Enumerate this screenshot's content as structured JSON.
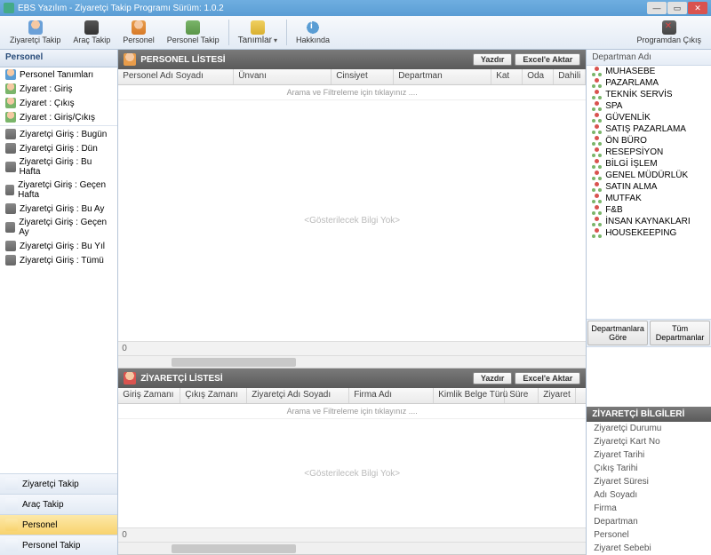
{
  "title": "EBS Yazılım  - Ziyaretçi Takip Programı Sürüm: 1.0.2",
  "toolbar": {
    "ziyaretci": "Ziyaretçi Takip",
    "arac": "Araç Takip",
    "personel": "Personel",
    "ptakip": "Personel Takip",
    "tanimlar": "Tanımlar",
    "hakkinda": "Hakkında",
    "cikis": "Programdan Çıkış"
  },
  "sidebar": {
    "header": "Personel",
    "items": [
      "Personel Tanımları",
      "Ziyaret : Giriş",
      "Ziyaret : Çıkış",
      "Ziyaret : Giriş/Çıkış",
      "Ziyaretçi Giriş : Bugün",
      "Ziyaretçi Giriş : Dün",
      "Ziyaretçi Giriş : Bu Hafta",
      "Ziyaretçi Giriş : Geçen Hafta",
      "Ziyaretçi Giriş : Bu Ay",
      "Ziyaretçi Giriş : Geçen Ay",
      "Ziyaretçi Giriş : Bu Yıl",
      "Ziyaretçi Giriş : Tümü"
    ],
    "nav": [
      "Ziyaretçi Takip",
      "Araç Takip",
      "Personel",
      "Personel Takip"
    ],
    "active": 2
  },
  "personel_panel": {
    "title": "PERSONEL LİSTESİ",
    "yazdir": "Yazdır",
    "excel": "Excel'e Aktar",
    "cols": [
      "Personel Adı Soyadı",
      "Ünvanı",
      "Cinsiyet",
      "Departman",
      "Kat",
      "Oda",
      "Dahili"
    ],
    "filter_hint": "Arama ve Filtreleme için tıklayınız ....",
    "empty": "<Gösterilecek Bilgi Yok>",
    "count": "0"
  },
  "ziyaretci_panel": {
    "title": "ZİYARETÇİ LİSTESİ",
    "yazdir": "Yazdır",
    "excel": "Excel'e Aktar",
    "cols": [
      "Giriş Zamanı",
      "Çıkış Zamanı",
      "Ziyaretçi Adı Soyadı",
      "Firma Adı",
      "Kimlik Belge Türü",
      "Süre",
      "Ziyaret"
    ],
    "filter_hint": "Arama ve Filtreleme için tıklayınız ....",
    "empty": "<Gösterilecek Bilgi Yok>",
    "count": "0"
  },
  "right": {
    "dept_header": "Departman Adı",
    "depts": [
      "MUHASEBE",
      "PAZARLAMA",
      "TEKNİK SERVİS",
      "SPA",
      "GÜVENLİK",
      "SATIŞ PAZARLAMA",
      "ÖN BÜRO",
      "RESEPSİYON",
      "BİLGİ İŞLEM",
      "GENEL MÜDÜRLÜK",
      "SATIN ALMA",
      "MUTFAK",
      "F&B",
      "İNSAN KAYNAKLARI",
      "HOUSEKEEPING"
    ],
    "btn1": "Departmanlara Göre",
    "btn2": "Tüm Departmanlar",
    "zb_title": "ZİYARETÇİ BİLGİLERİ",
    "zb_items": [
      "Ziyaretçi Durumu",
      "Ziyaretçi Kart No",
      "Ziyaret Tarihi",
      "Çıkış Tarihi",
      "Ziyaret Süresi",
      "Adı Soyadı",
      "Firma",
      "Departman",
      "Personel",
      "Ziyaret Sebebi"
    ]
  }
}
